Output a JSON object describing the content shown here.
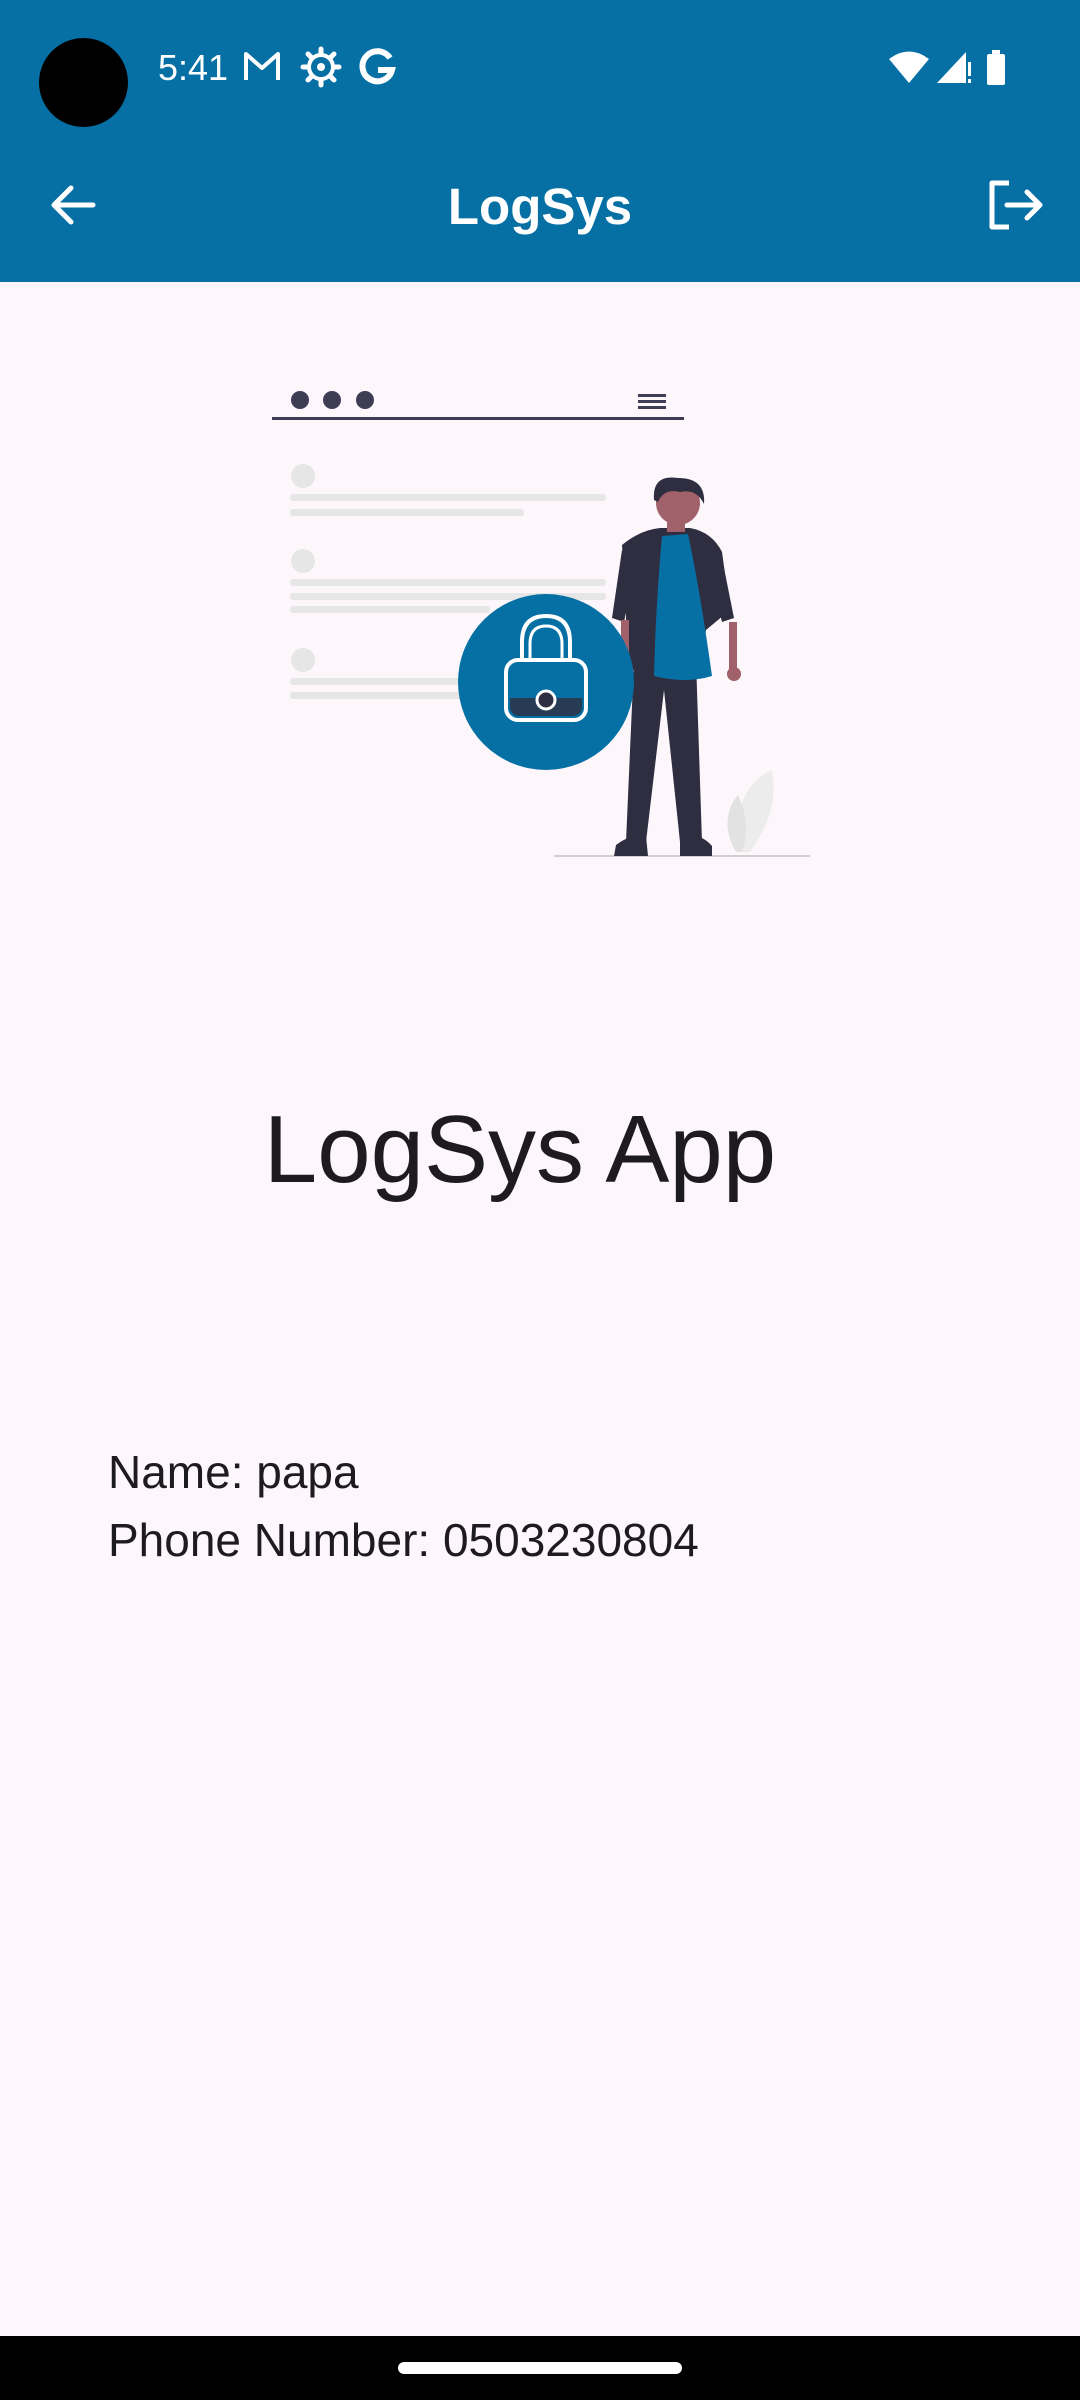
{
  "status_bar": {
    "time": "5:41",
    "icons": [
      "gmail-icon",
      "settings-gear-icon",
      "google-icon",
      "wifi-icon",
      "signal-icon",
      "battery-icon"
    ]
  },
  "app_bar": {
    "title": "LogSys",
    "back_icon": "arrow-left-icon",
    "logout_icon": "logout-icon"
  },
  "main": {
    "headline": "LogSys App",
    "name_line": "Name: papa",
    "phone_line": "Phone Number: 0503230804"
  },
  "colors": {
    "primary": "#0670a5",
    "background": "#fdf7fb",
    "text": "#1e1b20",
    "illustration_dark": "#3f3d56",
    "illustration_light": "#e6e6e6"
  }
}
